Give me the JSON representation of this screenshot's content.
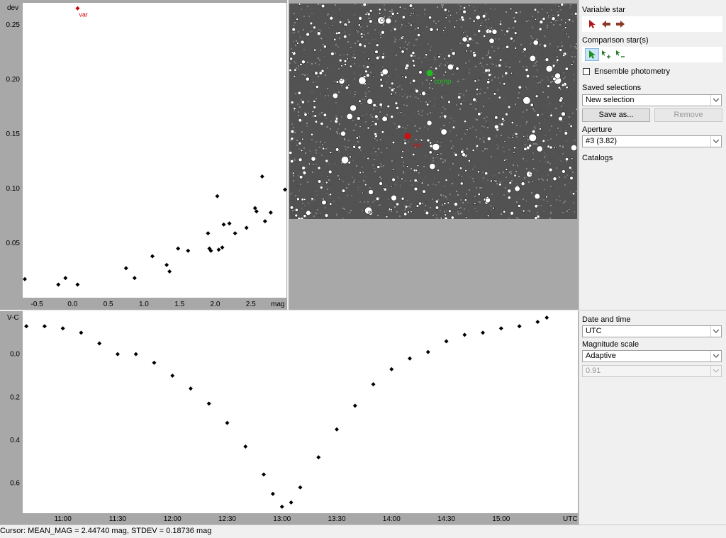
{
  "scatter": {
    "y_axis_label": "dev",
    "x_axis_label": "mag",
    "highlight_label": "var",
    "x_ticks": [
      "-0.5",
      "0.0",
      "0.5",
      "1.0",
      "1.5",
      "2.0",
      "2.5"
    ],
    "y_ticks": [
      "0.05",
      "0.10",
      "0.15",
      "0.20",
      "0.25"
    ]
  },
  "chart_data": [
    {
      "type": "scatter",
      "title": "",
      "xlabel": "mag",
      "ylabel": "dev",
      "xlim": [
        -0.7,
        3.0
      ],
      "ylim": [
        0.0,
        0.27
      ],
      "grid": false,
      "highlight": {
        "label": "var",
        "x": 0.07,
        "y": 0.265,
        "color": "#cc0000"
      },
      "x": [
        -0.67,
        -0.2,
        -0.1,
        0.07,
        0.75,
        0.87,
        1.12,
        1.32,
        1.36,
        1.48,
        1.62,
        1.9,
        1.92,
        1.94,
        2.03,
        2.05,
        2.1,
        2.12,
        2.2,
        2.28,
        2.44,
        2.56,
        2.58,
        2.66,
        2.7,
        2.78,
        2.98
      ],
      "y": [
        0.017,
        0.012,
        0.018,
        0.012,
        0.027,
        0.018,
        0.038,
        0.03,
        0.024,
        0.045,
        0.043,
        0.059,
        0.045,
        0.043,
        0.093,
        0.044,
        0.046,
        0.067,
        0.068,
        0.059,
        0.064,
        0.082,
        0.079,
        0.111,
        0.07,
        0.078,
        0.099
      ]
    },
    {
      "type": "scatter",
      "title": "",
      "xlabel": "UTC",
      "ylabel": "V-C",
      "xlim": [
        "10:38",
        "15:42"
      ],
      "ylim": [
        -0.2,
        0.74
      ],
      "y_inverted": true,
      "grid": false,
      "x_ticks": [
        "11:00",
        "11:30",
        "12:00",
        "12:30",
        "13:00",
        "13:30",
        "14:00",
        "14:30",
        "15:00"
      ],
      "y_ticks": [
        "0.0",
        "0.2",
        "0.4",
        "0.6"
      ],
      "x": [
        "10:40",
        "10:50",
        "11:00",
        "11:10",
        "11:20",
        "11:30",
        "11:40",
        "11:50",
        "12:00",
        "12:10",
        "12:20",
        "12:30",
        "12:40",
        "12:50",
        "12:55",
        "13:00",
        "13:05",
        "13:10",
        "13:20",
        "13:30",
        "13:40",
        "13:50",
        "14:00",
        "14:10",
        "14:20",
        "14:30",
        "14:40",
        "14:50",
        "15:00",
        "15:10",
        "15:20",
        "15:25"
      ],
      "y": [
        -0.13,
        -0.13,
        -0.12,
        -0.1,
        -0.05,
        0.0,
        0.0,
        0.04,
        0.1,
        0.16,
        0.23,
        0.32,
        0.43,
        0.56,
        0.65,
        0.71,
        0.69,
        0.62,
        0.48,
        0.35,
        0.24,
        0.14,
        0.07,
        0.02,
        -0.01,
        -0.06,
        -0.09,
        -0.1,
        -0.12,
        -0.13,
        -0.15,
        -0.17
      ]
    }
  ],
  "timeaxis": {
    "x_label": "UTC",
    "y_label": "V-C",
    "x_ticks": [
      "11:00",
      "11:30",
      "12:00",
      "12:30",
      "13:00",
      "13:30",
      "14:00",
      "14:30",
      "15:00"
    ],
    "y_ticks": [
      "0.0",
      "0.2",
      "0.4",
      "0.6"
    ]
  },
  "image": {
    "var_label": "var",
    "comp_label": "comp",
    "var_color": "#cc1111",
    "comp_color": "#22bb22"
  },
  "panel": {
    "variable_star_label": "Variable star",
    "comparison_label": "Comparison star(s)",
    "ensemble_label": "Ensemble photometry",
    "saved_selections_label": "Saved selections",
    "saved_selection_value": "New selection",
    "save_as_label": "Save as...",
    "remove_label": "Remove",
    "aperture_label": "Aperture",
    "aperture_value": "#3 (3.82)",
    "catalogs_label": "Catalogs",
    "date_time_label": "Date and time",
    "date_time_value": "UTC",
    "magnitude_scale_label": "Magnitude scale",
    "magnitude_scale_value": "Adaptive",
    "magnitude_range_value": "0.91"
  },
  "status": {
    "text": "Cursor: MEAN_MAG = 2.44740 mag, STDEV = 0.18736 mag"
  },
  "colors": {
    "plot_bg": "#ffffff",
    "axis_bg": "#a8a8a8",
    "accent_red": "#8b1a1a",
    "accent_green": "#2a9a2a"
  }
}
